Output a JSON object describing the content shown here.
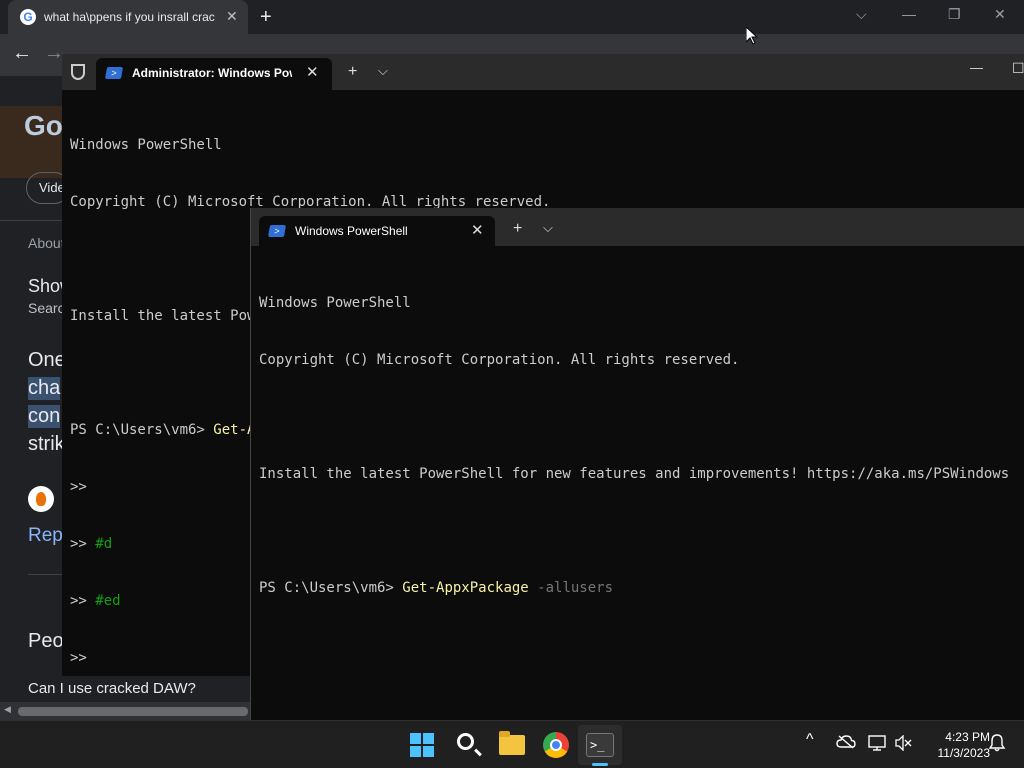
{
  "chrome": {
    "tab_title": "what ha\\ppens if you insrall crac",
    "tab_close": "✕",
    "new_tab": "+",
    "minimize": "—",
    "restore": "❐",
    "close": "✕",
    "dropdown": "⌵",
    "back": "←",
    "forward": "→",
    "page_fragments": {
      "videos_chip": "Vide",
      "about": "About",
      "show": "Show",
      "search": "Searc",
      "one": "One",
      "cha": "cha",
      "con": "con",
      "strik": "strik",
      "rep": "Rep",
      "peo": "Peo",
      "question": "Can I use cracked DAW?",
      "logo_text": "Go"
    }
  },
  "admin_terminal": {
    "tab_title": "Administrator: Windows Powe",
    "tab_close": "✕",
    "new_tab": "+",
    "dropdown": "⌵",
    "minimize": "—",
    "restore": "☐",
    "lines": {
      "l1": "Windows PowerShell",
      "l2": "Copyright (C) Microsoft Corporation. All rights reserved.",
      "l3": "Install the latest PowerShell for new features and improvements! https://aka.ms/PSWindows",
      "prompt": "PS C:\\Users\\vm6> ",
      "cmd": "Get-AppxPackage",
      "cont1": ">>",
      "cont2_prefix": ">> ",
      "cont2_comment": "#d",
      "cont3_prefix": ">> ",
      "cont3_comment": "#ed",
      "cont4": ">>"
    }
  },
  "user_terminal": {
    "tab_title": "Windows PowerShell",
    "tab_close": "✕",
    "new_tab": "+",
    "dropdown": "⌵",
    "lines": {
      "l1": "Windows PowerShell",
      "l2": "Copyright (C) Microsoft Corporation. All rights reserved.",
      "l3": "Install the latest PowerShell for new features and improvements! https://aka.ms/PSWindows",
      "prompt": "PS C:\\Users\\vm6> ",
      "cmd": "Get-AppxPackage",
      "param": " -allusers"
    }
  },
  "taskbar": {
    "clock_time": "4:23 PM",
    "clock_date": "11/3/2023",
    "tray_chevron": "^",
    "terminal_glyph": ">_",
    "icons": [
      "start-icon",
      "search-icon",
      "file-explorer-icon",
      "chrome-icon",
      "terminal-icon"
    ]
  },
  "colors": {
    "terminal_bg": "#0c0c0c",
    "command_yellow": "#f9f1a5",
    "comment_green": "#13a10e",
    "param_gray": "#767676",
    "accent_blue": "#4cc2ff"
  }
}
